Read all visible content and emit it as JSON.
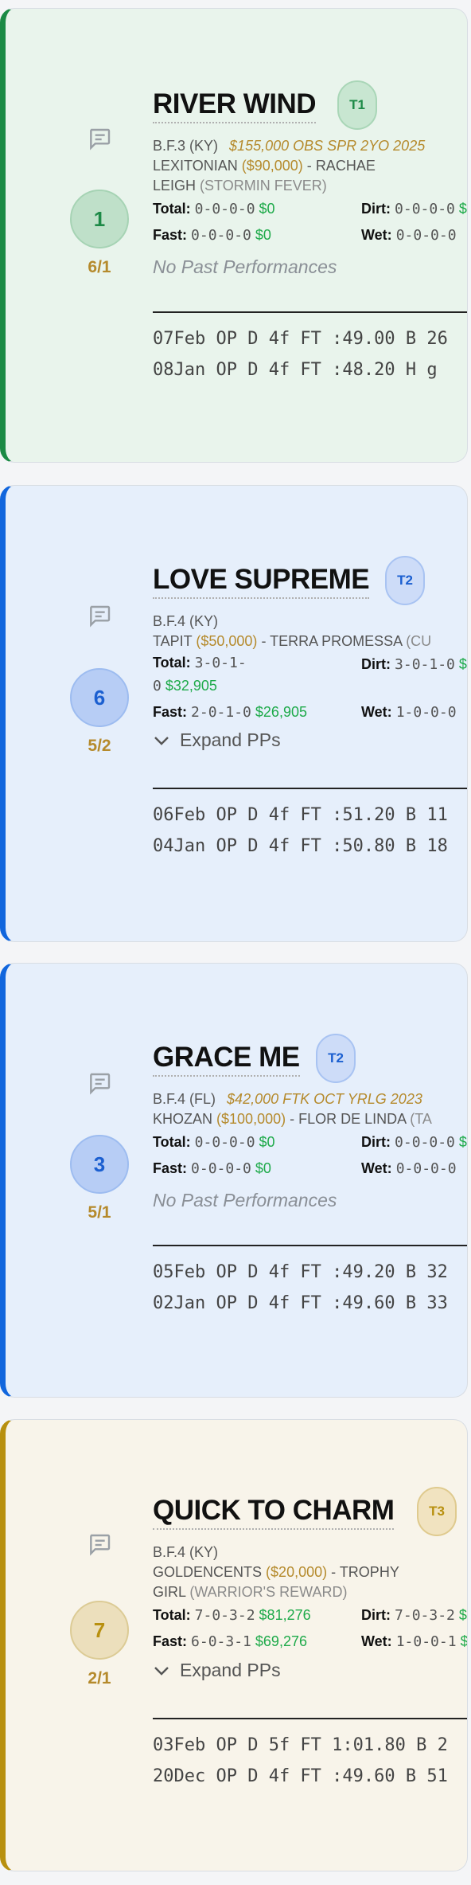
{
  "entries": [
    {
      "post": "1",
      "odds": "6/1",
      "name": "RIVER WIND",
      "trainer_tag": "T1",
      "age_sex": "B.F.3",
      "state": "(KY)",
      "sale": "$155,000 OBS SPR 2YO 2025",
      "sire": "LEXITONIAN",
      "sire_price": "($90,000)",
      "sep": "-",
      "dam": "RACHAE",
      "dam_line2": "LEIGH",
      "damsire": "(STORMIN FEVER)",
      "total": "0-0-0-0",
      "total_money": "$0",
      "dirt": "0-0-0-0",
      "dirt_money": "$",
      "fast": "0-0-0-0",
      "fast_money": "$0",
      "wet": "0-0-0-0",
      "pp_text": "No Past Performances",
      "works": [
        "07Feb OP D 4f FT :49.00 B 26",
        "08Jan OP D 4f FT :48.20 H g"
      ]
    },
    {
      "post": "6",
      "odds": "5/2",
      "name": "LOVE SUPREME",
      "trainer_tag": "T2",
      "age_sex": "B.F.4",
      "state": "(KY)",
      "sire": "TAPIT",
      "sire_price": "($50,000)",
      "sep": "-",
      "dam": "TERRA PROMESSA",
      "damsire": "(CU",
      "total": "3-0-1-",
      "total_line2": "0",
      "total_money": "$32,905",
      "dirt": "3-0-1-0",
      "dirt_money": "$",
      "fast": "2-0-1-0",
      "fast_money": "$26,905",
      "wet": "1-0-0-0",
      "pp_text": "Expand PPs",
      "works": [
        "06Feb OP D 4f FT :51.20 B 11",
        "04Jan OP D 4f FT :50.80 B 18"
      ]
    },
    {
      "post": "3",
      "odds": "5/1",
      "name": "GRACE ME",
      "trainer_tag": "T2",
      "age_sex": "B.F.4",
      "state": "(FL)",
      "sale": "$42,000 FTK OCT YRLG 2023",
      "sire": "KHOZAN",
      "sire_price": "($100,000)",
      "sep": "-",
      "dam": "FLOR DE LINDA",
      "damsire": "(TA",
      "total": "0-0-0-0",
      "total_money": "$0",
      "dirt": "0-0-0-0",
      "dirt_money": "$",
      "fast": "0-0-0-0",
      "fast_money": "$0",
      "wet": "0-0-0-0",
      "pp_text": "No Past Performances",
      "works": [
        "05Feb OP D 4f FT :49.20 B 32",
        "02Jan OP D 4f FT :49.60 B 33"
      ]
    },
    {
      "post": "7",
      "odds": "2/1",
      "name": "QUICK TO CHARM",
      "trainer_tag": "T3",
      "age_sex": "B.F.4",
      "state": "(KY)",
      "sire": "GOLDENCENTS",
      "sire_price": "($20,000)",
      "sep": "-",
      "dam": "TROPHY",
      "dam_line2": "GIRL",
      "damsire": "(WARRIOR'S REWARD)",
      "total": "7-0-3-2",
      "total_money": "$81,276",
      "dirt": "7-0-3-2",
      "dirt_money": "$",
      "fast": "6-0-3-1",
      "fast_money": "$69,276",
      "wet": "1-0-0-1",
      "wet_money": "$",
      "pp_text": "Expand PPs",
      "works": [
        "03Feb OP D 5f FT 1:01.80 B 2",
        "20Dec OP D 4f FT :49.60 B 51"
      ]
    }
  ],
  "labels": {
    "total": "Total:",
    "dirt": "Dirt:",
    "fast": "Fast:",
    "wet": "Wet:"
  },
  "colors": {
    "green": "#1b8a45",
    "blue": "#1166dd",
    "gold": "#b8900f",
    "money": "#1eaa4a"
  },
  "icons": {
    "comment": "chat-bubble-icon",
    "expand": "chevron-down-icon"
  }
}
